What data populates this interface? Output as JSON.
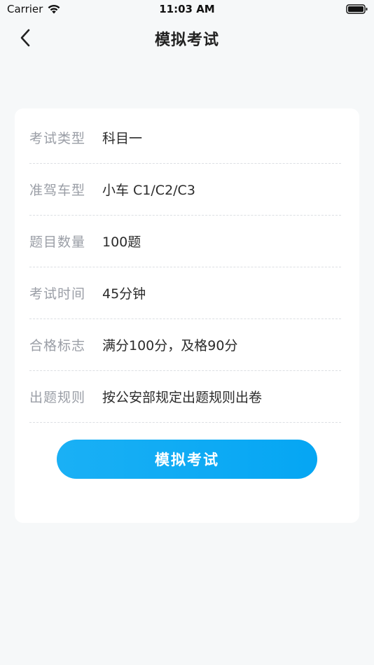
{
  "status_bar": {
    "carrier": "Carrier",
    "time": "11:03 AM"
  },
  "nav": {
    "title": "模拟考试",
    "back_icon": "chevron-left-icon"
  },
  "exam_info": {
    "rows": [
      {
        "label": "考试类型",
        "value": "科目一"
      },
      {
        "label": "准驾车型",
        "value": "小车 C1/C2/C3"
      },
      {
        "label": "题目数量",
        "value": "100题"
      },
      {
        "label": "考试时间",
        "value": "45分钟"
      },
      {
        "label": "合格标志",
        "value": "满分100分，及格90分"
      },
      {
        "label": "出题规则",
        "value": "按公安部规定出题规则出卷"
      }
    ]
  },
  "actions": {
    "start_label": "模拟考试"
  },
  "colors": {
    "background": "#f6f8f9",
    "card": "#ffffff",
    "accent": "#05a6f3",
    "label": "#9a9ea6",
    "value": "#2b2b2b"
  }
}
